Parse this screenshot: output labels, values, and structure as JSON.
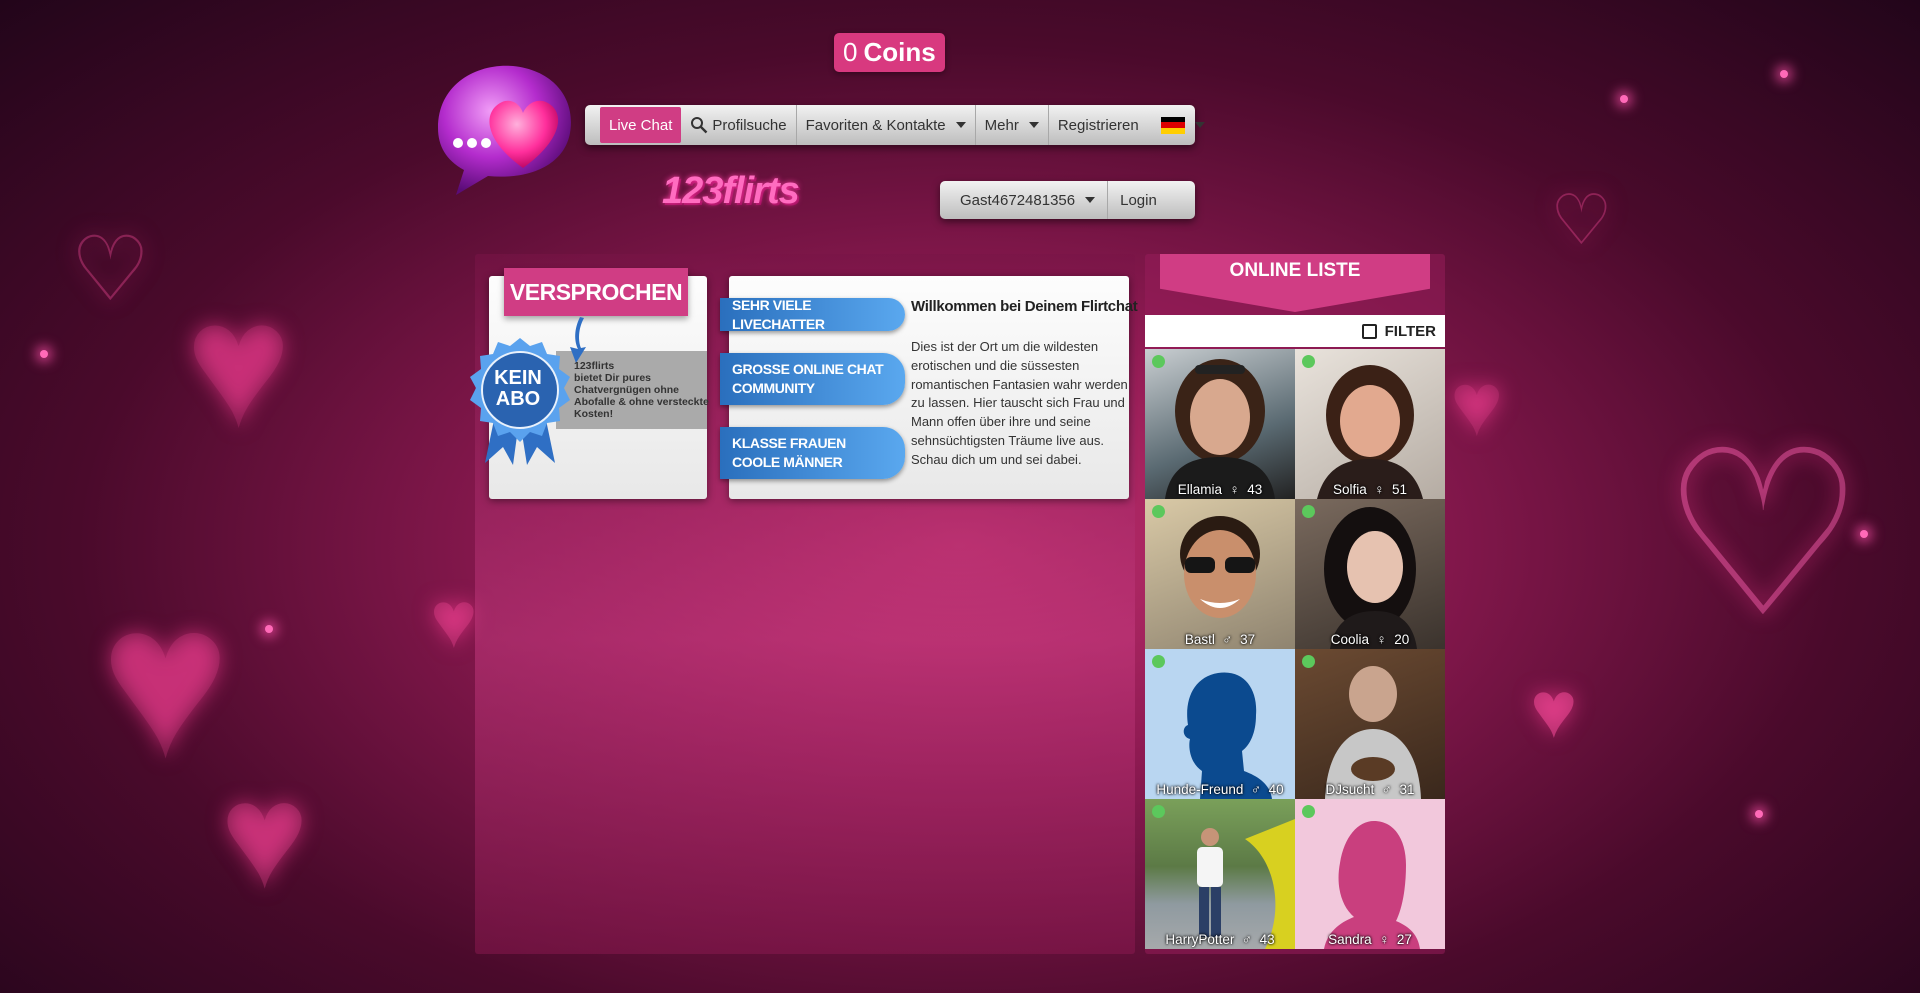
{
  "header": {
    "coins_count": "0",
    "coins_label": "Coins",
    "brand": "123flirts"
  },
  "nav": {
    "items": [
      {
        "label": "Live Chat",
        "active": true
      },
      {
        "label": "Profilsuche",
        "icon": "search-icon"
      },
      {
        "label": "Favoriten & Kontakte",
        "dropdown": true
      },
      {
        "label": "Mehr",
        "dropdown": true
      },
      {
        "label": "Registrieren"
      }
    ],
    "language_icon": "germany-flag-icon"
  },
  "user_bar": {
    "username": "Gast4672481356",
    "login_label": "Login"
  },
  "promise": {
    "banner": "VERSPROCHEN",
    "seal_line1": "KEIN",
    "seal_line2": "ABO",
    "text_line1": "123flirts",
    "text_line2": "bietet Dir pures",
    "text_line3": "Chatvergnügen ohne",
    "text_line4": "Abofalle & ohne versteckte",
    "text_line5": "Kosten!"
  },
  "features": {
    "tab1": "SEHR VIELE LIVECHATTER",
    "tab2_line1": "GROSSE ONLINE CHAT",
    "tab2_line2": "COMMUNITY",
    "tab3_line1": "KLASSE FRAUEN",
    "tab3_line2": "COOLE MÄNNER"
  },
  "welcome": {
    "title": "Willkommen bei Deinem Flirtchat",
    "body": "Dies ist der Ort um die wildesten erotischen und die süssesten romantischen Fantasien wahr werden zu lassen. Hier tauscht sich Frau und Mann offen über ihre und seine sehnsüchtigsten Träume live aus. Schau dich um und sei dabei."
  },
  "online_list": {
    "title": "ONLINE LISTE",
    "filter_label": "FILTER",
    "users": [
      {
        "name": "Ellamia",
        "age": "43",
        "gender_icon": "female-icon",
        "status": "online"
      },
      {
        "name": "Solfia",
        "age": "51",
        "gender_icon": "female-icon",
        "status": "online"
      },
      {
        "name": "Bastl",
        "age": "37",
        "gender_icon": "male-icon",
        "status": "online"
      },
      {
        "name": "Coolia",
        "age": "20",
        "gender_icon": "female-icon",
        "status": "online"
      },
      {
        "name": "Hunde-Freund",
        "age": "40",
        "gender_icon": "male-icon",
        "status": "online"
      },
      {
        "name": "DJsucht",
        "age": "31",
        "gender_icon": "male-icon",
        "status": "online"
      },
      {
        "name": "HarryPotter",
        "age": "43",
        "gender_icon": "male-icon",
        "status": "online"
      },
      {
        "name": "Sandra",
        "age": "27",
        "gender_icon": "female-icon",
        "status": "online"
      }
    ]
  },
  "colors": {
    "accent": "#d03d84",
    "nav_bg": "#d6d6d6",
    "online_dot": "#5cc85c",
    "feature_blue": "#3f8ad8"
  }
}
